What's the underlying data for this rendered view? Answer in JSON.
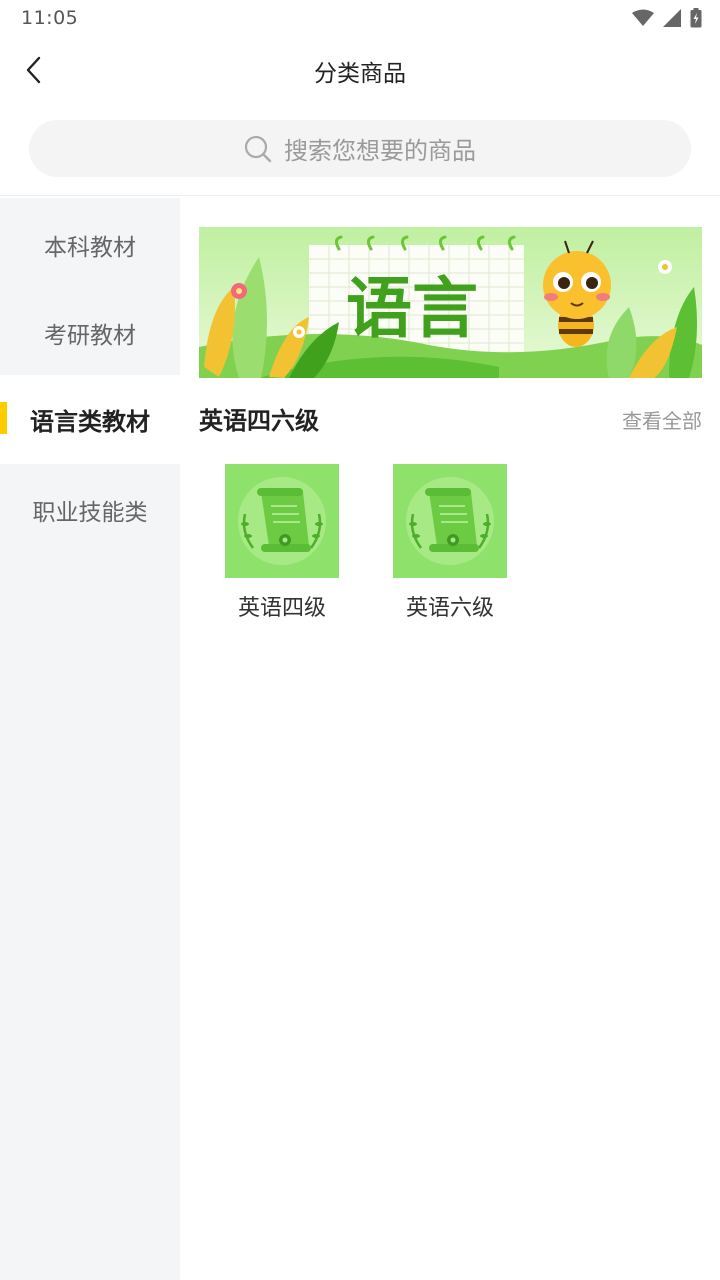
{
  "status_bar": {
    "time": "11:05",
    "icons": [
      "wifi-icon",
      "signal-icon",
      "battery-charging-icon"
    ]
  },
  "header": {
    "title": "分类商品",
    "back_icon": "chevron-left-icon"
  },
  "search": {
    "placeholder": "搜索您想要的商品",
    "icon": "search-icon"
  },
  "sidebar": {
    "items": [
      {
        "label": "本科教材",
        "active": false
      },
      {
        "label": "考研教材",
        "active": false
      },
      {
        "label": "语言类教材",
        "active": true
      },
      {
        "label": "职业技能类",
        "active": false
      }
    ]
  },
  "banner": {
    "text": "语言"
  },
  "section": {
    "title": "英语四六级",
    "view_all": "查看全部"
  },
  "products": [
    {
      "label": "英语四级",
      "icon": "certificate-scroll-icon"
    },
    {
      "label": "英语六级",
      "icon": "certificate-scroll-icon"
    }
  ],
  "colors": {
    "accent": "#ffcc00",
    "sidebar_bg": "#f4f5f7",
    "product_bg": "#8ee26b",
    "banner_text": "#3fa11c"
  }
}
